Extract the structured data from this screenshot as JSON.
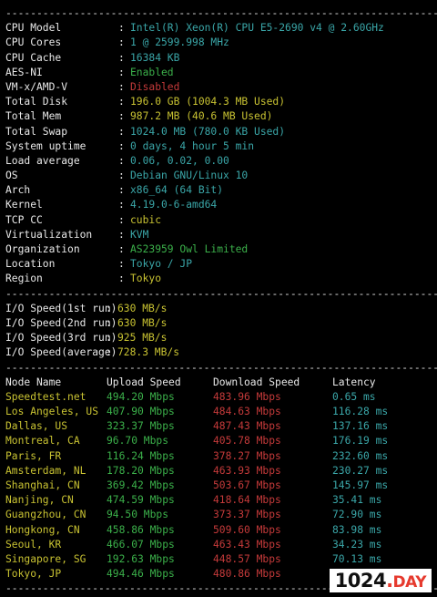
{
  "system": [
    {
      "key": "CPU Model",
      "value": "Intel(R) Xeon(R) CPU E5-2690 v4 @ 2.60GHz",
      "color": "cyan"
    },
    {
      "key": "CPU Cores",
      "value": "1 @ 2599.998 MHz",
      "color": "cyan"
    },
    {
      "key": "CPU Cache",
      "value": "16384 KB",
      "color": "cyan"
    },
    {
      "key": "AES-NI",
      "value": "Enabled",
      "color": "green"
    },
    {
      "key": "VM-x/AMD-V",
      "value": "Disabled",
      "color": "red"
    },
    {
      "key": "Total Disk",
      "value": "196.0 GB (1004.3 MB Used)",
      "color": "yellow"
    },
    {
      "key": "Total Mem",
      "value": "987.2 MB (40.6 MB Used)",
      "color": "yellow"
    },
    {
      "key": "Total Swap",
      "value": "1024.0 MB (780.0 KB Used)",
      "color": "cyan"
    },
    {
      "key": "System uptime",
      "value": "0 days, 4 hour 5 min",
      "color": "cyan"
    },
    {
      "key": "Load average",
      "value": "0.06, 0.02, 0.00",
      "color": "cyan"
    },
    {
      "key": "OS",
      "value": "Debian GNU/Linux 10",
      "color": "cyan"
    },
    {
      "key": "Arch",
      "value": "x86_64 (64 Bit)",
      "color": "cyan"
    },
    {
      "key": "Kernel",
      "value": "4.19.0-6-amd64",
      "color": "cyan"
    },
    {
      "key": "TCP CC",
      "value": "cubic",
      "color": "yellow"
    },
    {
      "key": "Virtualization",
      "value": "KVM",
      "color": "cyan"
    },
    {
      "key": "Organization",
      "value": "AS23959 Owl Limited",
      "color": "green"
    },
    {
      "key": "Location",
      "value": "Tokyo / JP",
      "color": "cyan"
    },
    {
      "key": "Region",
      "value": "Tokyo",
      "color": "yellow"
    }
  ],
  "separator": "----------------------------------------------------------------------",
  "io": [
    {
      "key": "I/O Speed(1st run)",
      "value": "630 MB/s"
    },
    {
      "key": "I/O Speed(2nd run)",
      "value": "630 MB/s"
    },
    {
      "key": "I/O Speed(3rd run)",
      "value": "925 MB/s"
    },
    {
      "key": "I/O Speed(average)",
      "value": "728.3 MB/s"
    }
  ],
  "speed_header": {
    "node": "Node Name",
    "upload": "Upload Speed",
    "download": "Download Speed",
    "latency": "Latency"
  },
  "speed": [
    {
      "node": "Speedtest.net",
      "upload": "494.20 Mbps",
      "download": "483.96 Mbps",
      "latency": "0.65 ms"
    },
    {
      "node": "Los Angeles, US",
      "upload": "407.90 Mbps",
      "download": "484.63 Mbps",
      "latency": "116.28 ms"
    },
    {
      "node": "Dallas, US",
      "upload": "323.37 Mbps",
      "download": "487.43 Mbps",
      "latency": "137.16 ms"
    },
    {
      "node": "Montreal, CA",
      "upload": "96.70 Mbps",
      "download": "405.78 Mbps",
      "latency": "176.19 ms"
    },
    {
      "node": "Paris, FR",
      "upload": "116.24 Mbps",
      "download": "378.27 Mbps",
      "latency": "232.60 ms"
    },
    {
      "node": "Amsterdam, NL",
      "upload": "178.20 Mbps",
      "download": "463.93 Mbps",
      "latency": "230.27 ms"
    },
    {
      "node": "Shanghai, CN",
      "upload": "369.42 Mbps",
      "download": "503.67 Mbps",
      "latency": "145.97 ms"
    },
    {
      "node": "Nanjing, CN",
      "upload": "474.59 Mbps",
      "download": "418.64 Mbps",
      "latency": "35.41 ms"
    },
    {
      "node": "Guangzhou, CN",
      "upload": "94.50 Mbps",
      "download": "373.37 Mbps",
      "latency": "72.90 ms"
    },
    {
      "node": "Hongkong, CN",
      "upload": "458.86 Mbps",
      "download": "509.60 Mbps",
      "latency": "83.98 ms"
    },
    {
      "node": "Seoul, KR",
      "upload": "466.07 Mbps",
      "download": "463.43 Mbps",
      "latency": "34.23 ms"
    },
    {
      "node": "Singapore, SG",
      "upload": "192.63 Mbps",
      "download": "448.57 Mbps",
      "latency": "70.13 ms"
    },
    {
      "node": "Tokyo, JP",
      "upload": "494.46 Mbps",
      "download": "480.86 Mbps",
      "latency": "0.85 ms"
    }
  ],
  "logo": {
    "number": "1024",
    "dot": ".",
    "suffix": "DAY"
  },
  "colors": {
    "cyan": "#3aa6a8",
    "green": "#3bb04a",
    "red": "#c53a3a",
    "yellow": "#c8c232",
    "background": "#000000"
  }
}
